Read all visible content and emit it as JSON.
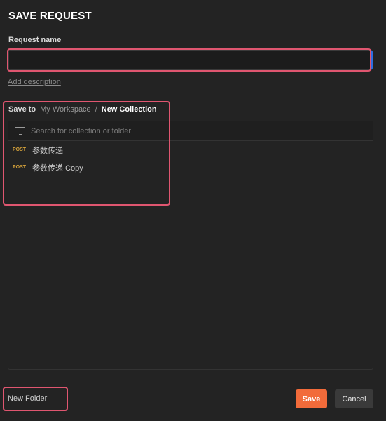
{
  "dialog": {
    "title": "SAVE REQUEST",
    "request_name_label": "Request name",
    "request_name_value": "",
    "add_description": "Add description"
  },
  "save_to": {
    "label": "Save to",
    "breadcrumb": [
      "My Workspace",
      "New Collection"
    ],
    "separator": "/"
  },
  "search": {
    "placeholder": "Search for collection or folder",
    "icon": "filter-icon"
  },
  "requests": [
    {
      "method": "POST",
      "name": "参数传递"
    },
    {
      "method": "POST",
      "name": "参数传递 Copy"
    }
  ],
  "footer": {
    "new_folder": "New Folder",
    "save": "Save",
    "cancel": "Cancel"
  },
  "colors": {
    "accent": "#f26b3a",
    "highlight": "#e05670",
    "method_post": "#d5a23a",
    "focus": "#2f6de0"
  }
}
